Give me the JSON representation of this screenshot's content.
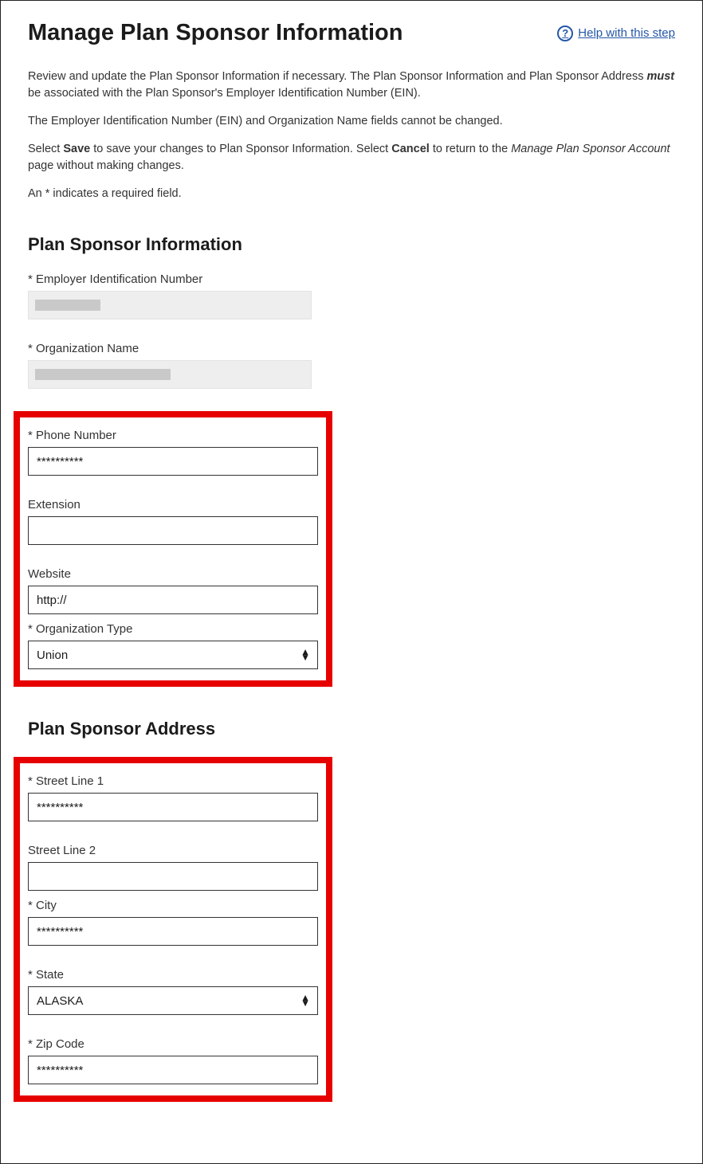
{
  "header": {
    "title": "Manage Plan Sponsor Information",
    "help_label": " Help with this step"
  },
  "intro": {
    "p1_a": "Review and update the Plan Sponsor Information if necessary. The Plan Sponsor Information and Plan Sponsor Address ",
    "p1_must": "must",
    "p1_b": " be associated with the Plan Sponsor's Employer Identification Number (EIN).",
    "p2": "The Employer Identification Number (EIN) and Organization Name fields cannot be changed.",
    "p3_a": "Select ",
    "p3_save": "Save",
    "p3_b": " to save your changes to Plan Sponsor Information. Select ",
    "p3_cancel": "Cancel",
    "p3_c": " to return to the ",
    "p3_link": "Manage Plan Sponsor Account",
    "p3_d": " page without making changes.",
    "p4": "An * indicates a required field."
  },
  "section_info": {
    "title": "Plan Sponsor Information",
    "ein_label": "* Employer Identification Number",
    "org_name_label": "* Organization Name",
    "phone_label": "* Phone Number",
    "phone_value": "**********",
    "ext_label": "Extension",
    "ext_value": "",
    "website_label": "Website",
    "website_value": "http://",
    "org_type_label": "* Organization Type",
    "org_type_value": "Union"
  },
  "section_addr": {
    "title": "Plan Sponsor Address",
    "street1_label": "* Street Line 1",
    "street1_value": "**********",
    "street2_label": "Street Line 2",
    "street2_value": "",
    "city_label": "* City",
    "city_value": "**********",
    "state_label": "* State",
    "state_value": "ALASKA",
    "zip_label": "* Zip Code",
    "zip_value": "**********"
  }
}
